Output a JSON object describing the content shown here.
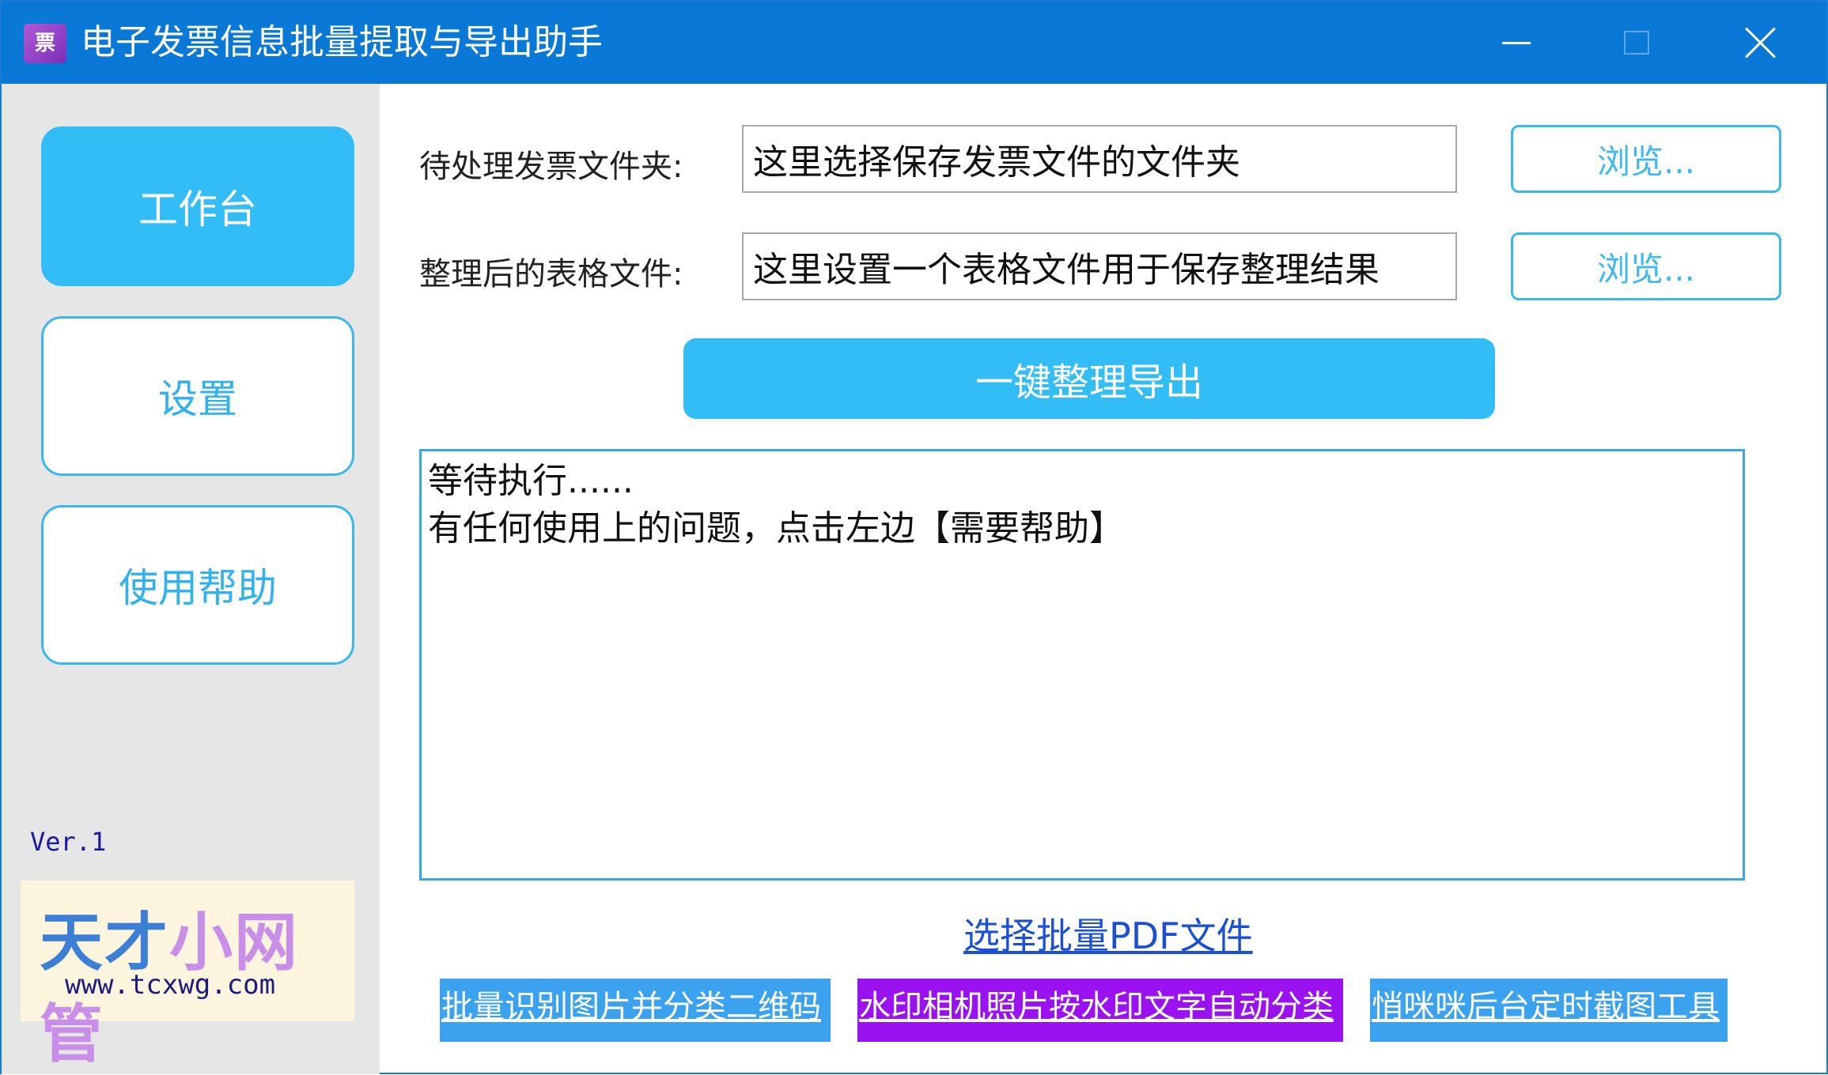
{
  "window": {
    "title": "电子发票信息批量提取与导出助手",
    "icon": "app-icon",
    "controls": {
      "minimize": "minimize-icon",
      "maximize": "maximize-icon",
      "close": "close-icon"
    }
  },
  "sidebar": {
    "items": [
      {
        "label": "工作台",
        "active": true
      },
      {
        "label": "设置",
        "active": false
      },
      {
        "label": "使用帮助",
        "active": false
      }
    ],
    "version": "Ver.1",
    "logo": {
      "part1": "天才",
      "part2": "小网管",
      "url": "www.tcxwg.com"
    }
  },
  "form": {
    "folder_label": "待处理发票文件夹:",
    "folder_value": "这里选择保存发票文件的文件夹",
    "table_label": "整理后的表格文件:",
    "table_value": "这里设置一个表格文件用于保存整理结果",
    "browse_label": "浏览...",
    "export_label": "一键整理导出"
  },
  "log": {
    "lines": [
      "等待执行......",
      "有任何使用上的问题，点击左边【需要帮助】"
    ]
  },
  "links": {
    "pdf": "选择批量PDF文件",
    "tools": [
      "批量识别图片并分类二维码",
      "水印相机照片按水印文字自动分类",
      "悄咪咪后台定时截图工具"
    ]
  },
  "colors": {
    "titlebar": "#0a78d7",
    "accent": "#33bdf7",
    "sidebar_bg": "#e6e6e6",
    "purple_link": "#9a12f0",
    "blue_link": "#3aa2ee"
  }
}
